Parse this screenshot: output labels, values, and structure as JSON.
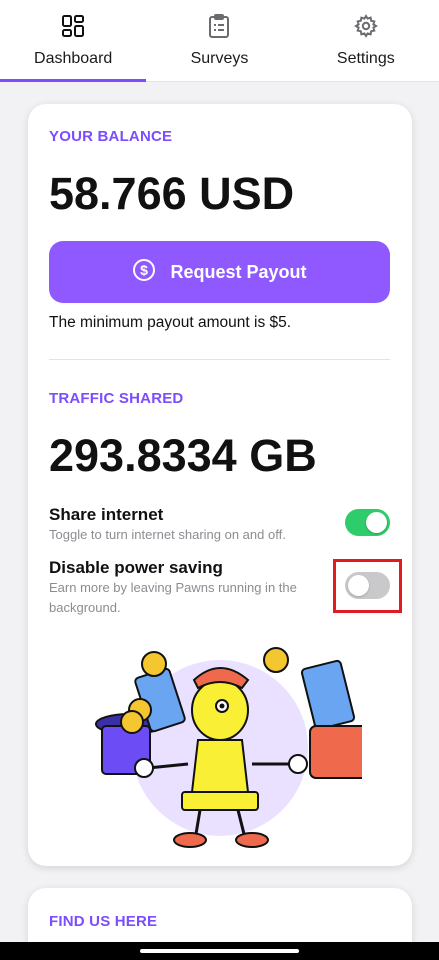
{
  "tabs": [
    {
      "label": "Dashboard",
      "icon": "dashboard-icon",
      "active": true
    },
    {
      "label": "Surveys",
      "icon": "clipboard-icon",
      "active": false
    },
    {
      "label": "Settings",
      "icon": "gear-icon",
      "active": false
    }
  ],
  "balance": {
    "title": "YOUR BALANCE",
    "amount": "58.766 USD",
    "payout_label": "Request Payout",
    "payout_icon": "dollar-icon",
    "min_note": "The minimum payout amount is $5."
  },
  "traffic": {
    "title": "TRAFFIC SHARED",
    "amount": "293.8334 GB"
  },
  "share_internet": {
    "title": "Share internet",
    "subtitle": "Toggle to turn internet sharing on and off.",
    "enabled": true
  },
  "power_saving": {
    "title": "Disable power saving",
    "subtitle": "Earn more by leaving Pawns running in the background.",
    "enabled": false
  },
  "find_us": {
    "title": "FIND US HERE"
  },
  "colors": {
    "accent": "#7b4dff",
    "button": "#8f59ff",
    "toggle_on": "#2ecc6a",
    "toggle_off": "#c9c9cc",
    "highlight": "#e11b22"
  }
}
